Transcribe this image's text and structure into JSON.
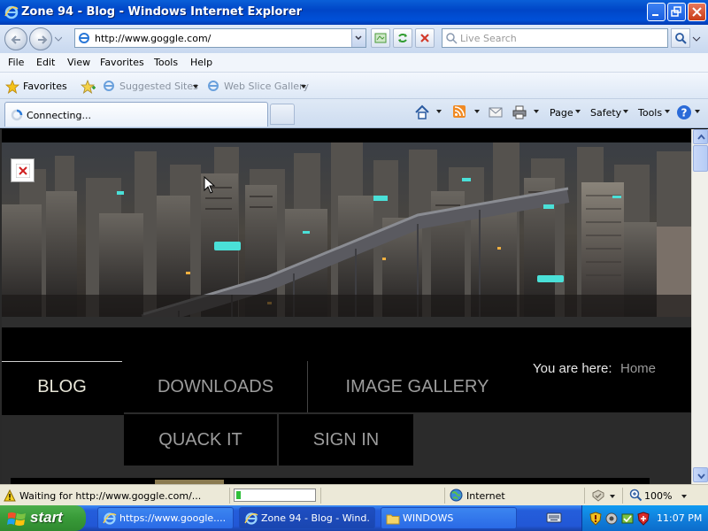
{
  "window": {
    "title": "Zone 94 - Blog - Windows Internet Explorer"
  },
  "address_bar": {
    "url": "http://www.goggle.com/",
    "search_placeholder": "Live Search"
  },
  "menu": {
    "items": [
      "File",
      "Edit",
      "View",
      "Favorites",
      "Tools",
      "Help"
    ]
  },
  "favorites_bar": {
    "favorites_label": "Favorites",
    "suggested_sites": "Suggested Sites",
    "web_slice_gallery": "Web Slice Gallery"
  },
  "tabs": {
    "active_label": "Connecting..."
  },
  "command_bar": {
    "page": "Page",
    "safety": "Safety",
    "tools": "Tools"
  },
  "page": {
    "breadcrumb_label": "You are here:",
    "breadcrumb_home": "Home",
    "nav": {
      "blog": "BLOG",
      "downloads": "DOWNLOADS",
      "image_gallery": "IMAGE GALLERY",
      "quack_it": "QUACK IT",
      "sign_in": "SIGN IN"
    }
  },
  "status_bar": {
    "status_text": "Waiting for http://www.goggle.com/...",
    "progress_fraction": 0.06,
    "zone": "Internet",
    "zoom": "100%"
  },
  "taskbar": {
    "start_label": "start",
    "items": [
      "https://www.google....",
      "Zone 94 - Blog - Wind...",
      "WINDOWS"
    ],
    "clock": "11:07 PM"
  },
  "colors": {
    "titlebar_blue": "#0046c7",
    "nav_active_text": "#e8e6d8",
    "nav_inactive_text": "#9c9c9c",
    "taskbar_blue": "#245edb",
    "start_green": "#389a38"
  }
}
